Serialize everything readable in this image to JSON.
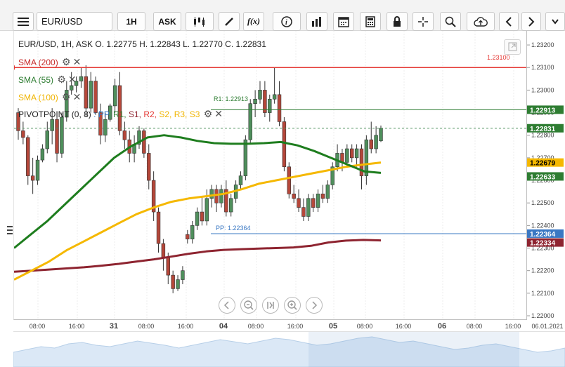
{
  "toolbar": {
    "symbol": "EUR/USD",
    "timeframe": "1H",
    "price_side": "ASK",
    "buttons": [
      {
        "name": "menu-icon"
      },
      {
        "name": "candlestick-type-icon"
      },
      {
        "name": "draw-pen-icon"
      },
      {
        "name": "function-fx-icon",
        "label": "f(x)"
      },
      {
        "name": "info-icon"
      },
      {
        "name": "volume-bars-icon"
      },
      {
        "name": "calendar-icon"
      },
      {
        "name": "calculator-icon"
      },
      {
        "name": "lock-icon"
      },
      {
        "name": "crosshair-icon"
      },
      {
        "name": "zoom-icon"
      },
      {
        "name": "cloud-upload-icon"
      },
      {
        "name": "chevron-left-icon"
      },
      {
        "name": "chevron-right-icon"
      }
    ]
  },
  "header": {
    "ohlc": "EUR/USD, 1H, ASK   O. 1.22775 H. 1.22843 L. 1.22770 C. 1.22831"
  },
  "indicators": [
    {
      "label": "SMA (200)",
      "color": "#c62828"
    },
    {
      "label": "SMA (55)",
      "color": "#2e7d32"
    },
    {
      "label": "SMA (100)",
      "color": "#f5b800"
    }
  ],
  "pivot": {
    "prefix": "PIVOTPOINT (0, 8)",
    "parts": [
      {
        "text": " : PP,",
        "color": "#3a78c3"
      },
      {
        "text": " R1,",
        "color": "#2e7d32"
      },
      {
        "text": " S1,",
        "color": "#8e2430"
      },
      {
        "text": " R2,",
        "color": "#e53935"
      },
      {
        "text": " S2,",
        "color": "#f5b800"
      },
      {
        "text": " R3,",
        "color": "#f5b800"
      },
      {
        "text": " S3",
        "color": "#f5b800"
      }
    ]
  },
  "lines": {
    "r2_label": "1.23100",
    "r1_label": "R1: 1.22913",
    "pp_label": "PP: 1.22364"
  },
  "price_axis": {
    "ticks": [
      "1.23200",
      "1.23100",
      "1.23000",
      "1.22900",
      "1.22800",
      "1.22700",
      "1.22600",
      "1.22500",
      "1.22400",
      "1.22300",
      "1.22200",
      "1.22100",
      "1.22000"
    ],
    "badges": [
      {
        "value": "1.22913",
        "bg": "#2e7d32",
        "fg": "#ffffff"
      },
      {
        "value": "1.22831",
        "bg": "#2e7d32",
        "fg": "#ffffff"
      },
      {
        "value": "1.22679",
        "bg": "#f5b800",
        "fg": "#000000"
      },
      {
        "value": "1.22633",
        "bg": "#2e7d32",
        "fg": "#ffffff"
      },
      {
        "value": "1.22364",
        "bg": "#3a78c3",
        "fg": "#ffffff"
      },
      {
        "value": "1.22334",
        "bg": "#8e2430",
        "fg": "#ffffff"
      }
    ]
  },
  "time_axis": {
    "labels": [
      "08:00",
      "16:00",
      "31",
      "08:00",
      "16:00",
      "04",
      "08:00",
      "16:00",
      "05",
      "08:00",
      "16:00",
      "06",
      "08:00",
      "16:00",
      "06.01.2021"
    ],
    "bold": [
      "31",
      "04",
      "05",
      "06"
    ]
  },
  "colors": {
    "bull": "#4f8f5c",
    "bear": "#b5473a",
    "sma200": "#8e2430",
    "sma55": "#1e7d1e",
    "sma100": "#f5b800",
    "pp": "#3a78c3",
    "r1": "#2e7d32",
    "r2": "#e53935"
  },
  "chart_data": {
    "type": "candlestick",
    "symbol": "EUR/USD",
    "ylim": [
      1.22,
      1.2325
    ],
    "candles": [
      [
        1.229,
        1.2292,
        1.2278,
        1.2282
      ],
      [
        1.2282,
        1.2286,
        1.2276,
        1.2279
      ],
      [
        1.2279,
        1.228,
        1.2258,
        1.2262
      ],
      [
        1.2262,
        1.227,
        1.2254,
        1.226
      ],
      [
        1.226,
        1.2271,
        1.2258,
        1.2269
      ],
      [
        1.2269,
        1.2276,
        1.2268,
        1.2274
      ],
      [
        1.2274,
        1.2286,
        1.2272,
        1.2282
      ],
      [
        1.2282,
        1.2292,
        1.2276,
        1.2287
      ],
      [
        1.2287,
        1.2288,
        1.2268,
        1.2272
      ],
      [
        1.2272,
        1.229,
        1.227,
        1.2288
      ],
      [
        1.2288,
        1.2304,
        1.2286,
        1.23
      ],
      [
        1.23,
        1.2308,
        1.2298,
        1.2302
      ],
      [
        1.2302,
        1.2306,
        1.2299,
        1.2304
      ],
      [
        1.2304,
        1.231,
        1.2301,
        1.2306
      ],
      [
        1.2306,
        1.2311,
        1.2288,
        1.2292
      ],
      [
        1.2292,
        1.2308,
        1.229,
        1.2304
      ],
      [
        1.2304,
        1.2306,
        1.2289,
        1.229
      ],
      [
        1.229,
        1.2294,
        1.2276,
        1.228
      ],
      [
        1.228,
        1.229,
        1.2277,
        1.2287
      ],
      [
        1.2287,
        1.2294,
        1.2286,
        1.2293
      ],
      [
        1.2293,
        1.2305,
        1.229,
        1.2302
      ],
      [
        1.2302,
        1.2308,
        1.228,
        1.2282
      ],
      [
        1.2282,
        1.2286,
        1.2274,
        1.2278
      ],
      [
        1.2278,
        1.2282,
        1.2268,
        1.2272
      ],
      [
        1.2272,
        1.228,
        1.2268,
        1.2276
      ],
      [
        1.2276,
        1.2284,
        1.2274,
        1.2282
      ],
      [
        1.2282,
        1.2283,
        1.227,
        1.2272
      ],
      [
        1.2272,
        1.2276,
        1.2256,
        1.226
      ],
      [
        1.226,
        1.2264,
        1.2242,
        1.2246
      ],
      [
        1.2246,
        1.2248,
        1.2228,
        1.2232
      ],
      [
        1.2232,
        1.2234,
        1.222,
        1.2226
      ],
      [
        1.2226,
        1.2228,
        1.2214,
        1.2218
      ],
      [
        1.2218,
        1.222,
        1.221,
        1.2212
      ],
      [
        1.2212,
        1.2218,
        1.2211,
        1.2216
      ],
      [
        1.2216,
        1.2222,
        1.2214,
        1.222
      ],
      [
        1.2236,
        1.2238,
        1.2232,
        1.2234
      ],
      [
        1.2234,
        1.2242,
        1.2232,
        1.224
      ],
      [
        1.224,
        1.2248,
        1.2238,
        1.2246
      ],
      [
        1.2246,
        1.2253,
        1.224,
        1.2242
      ],
      [
        1.2242,
        1.2256,
        1.224,
        1.2252
      ],
      [
        1.2252,
        1.2258,
        1.2248,
        1.2256
      ],
      [
        1.2256,
        1.2258,
        1.2246,
        1.225
      ],
      [
        1.225,
        1.2258,
        1.2248,
        1.2256
      ],
      [
        1.2256,
        1.226,
        1.2244,
        1.2246
      ],
      [
        1.2246,
        1.2254,
        1.2244,
        1.2252
      ],
      [
        1.2252,
        1.226,
        1.225,
        1.2258
      ],
      [
        1.2258,
        1.2264,
        1.2256,
        1.2262
      ],
      [
        1.2262,
        1.228,
        1.226,
        1.2278
      ],
      [
        1.2278,
        1.2296,
        1.2276,
        1.2294
      ],
      [
        1.2294,
        1.23,
        1.2288,
        1.2296
      ],
      [
        1.2296,
        1.2304,
        1.2294,
        1.23
      ],
      [
        1.23,
        1.2304,
        1.2288,
        1.229
      ],
      [
        1.229,
        1.2298,
        1.2286,
        1.2296
      ],
      [
        1.2296,
        1.231,
        1.2294,
        1.2298
      ],
      [
        1.2298,
        1.2304,
        1.2284,
        1.2286
      ],
      [
        1.2286,
        1.2288,
        1.2264,
        1.2266
      ],
      [
        1.2266,
        1.2268,
        1.2252,
        1.2254
      ],
      [
        1.2254,
        1.2258,
        1.225,
        1.2252
      ],
      [
        1.2252,
        1.2256,
        1.2246,
        1.2248
      ],
      [
        1.2248,
        1.2252,
        1.2242,
        1.2244
      ],
      [
        1.2244,
        1.2254,
        1.2242,
        1.2252
      ],
      [
        1.2252,
        1.2254,
        1.2246,
        1.2248
      ],
      [
        1.2248,
        1.2256,
        1.2246,
        1.2254
      ],
      [
        1.2254,
        1.2258,
        1.225,
        1.2252
      ],
      [
        1.2252,
        1.226,
        1.225,
        1.2258
      ],
      [
        1.2258,
        1.2268,
        1.2256,
        1.2266
      ],
      [
        1.2266,
        1.2276,
        1.2264,
        1.2272
      ],
      [
        1.2272,
        1.2274,
        1.2264,
        1.2268
      ],
      [
        1.2268,
        1.2276,
        1.2266,
        1.2274
      ],
      [
        1.2274,
        1.2276,
        1.2268,
        1.227
      ],
      [
        1.227,
        1.2276,
        1.2266,
        1.2274
      ],
      [
        1.2274,
        1.2276,
        1.2256,
        1.2262
      ],
      [
        1.2262,
        1.228,
        1.2258,
        1.2278
      ],
      [
        1.2278,
        1.2286,
        1.2272,
        1.2274
      ],
      [
        1.2274,
        1.2284,
        1.2272,
        1.228
      ],
      [
        1.22775,
        1.22843,
        1.2277,
        1.22831
      ]
    ],
    "sma200": [
      1.22195,
      1.222,
      1.22205,
      1.2221,
      1.22215,
      1.22222,
      1.2223,
      1.2224,
      1.2225,
      1.22262,
      1.22275,
      1.22285,
      1.22292,
      1.22295,
      1.22298,
      1.223,
      1.22303,
      1.2231,
      1.22325,
      1.22333,
      1.22336,
      1.22334
    ],
    "sma55": [
      1.223,
      1.2236,
      1.2242,
      1.2249,
      1.2256,
      1.2263,
      1.227,
      1.2275,
      1.2279,
      1.228,
      1.2279,
      1.22775,
      1.22765,
      1.22762,
      1.22762,
      1.22765,
      1.2277,
      1.22755,
      1.2273,
      1.227,
      1.2267,
      1.2264,
      1.22633
    ],
    "sma100": [
      1.2216,
      1.222,
      1.2224,
      1.2229,
      1.2233,
      1.2237,
      1.2241,
      1.2245,
      1.2248,
      1.22505,
      1.2252,
      1.2253,
      1.2254,
      1.2256,
      1.22585,
      1.226,
      1.22615,
      1.2263,
      1.22645,
      1.2266,
      1.2267,
      1.22679
    ],
    "levels": {
      "r2": 1.231,
      "r1": 1.22913,
      "pp": 1.22364,
      "last": 1.22831
    }
  }
}
